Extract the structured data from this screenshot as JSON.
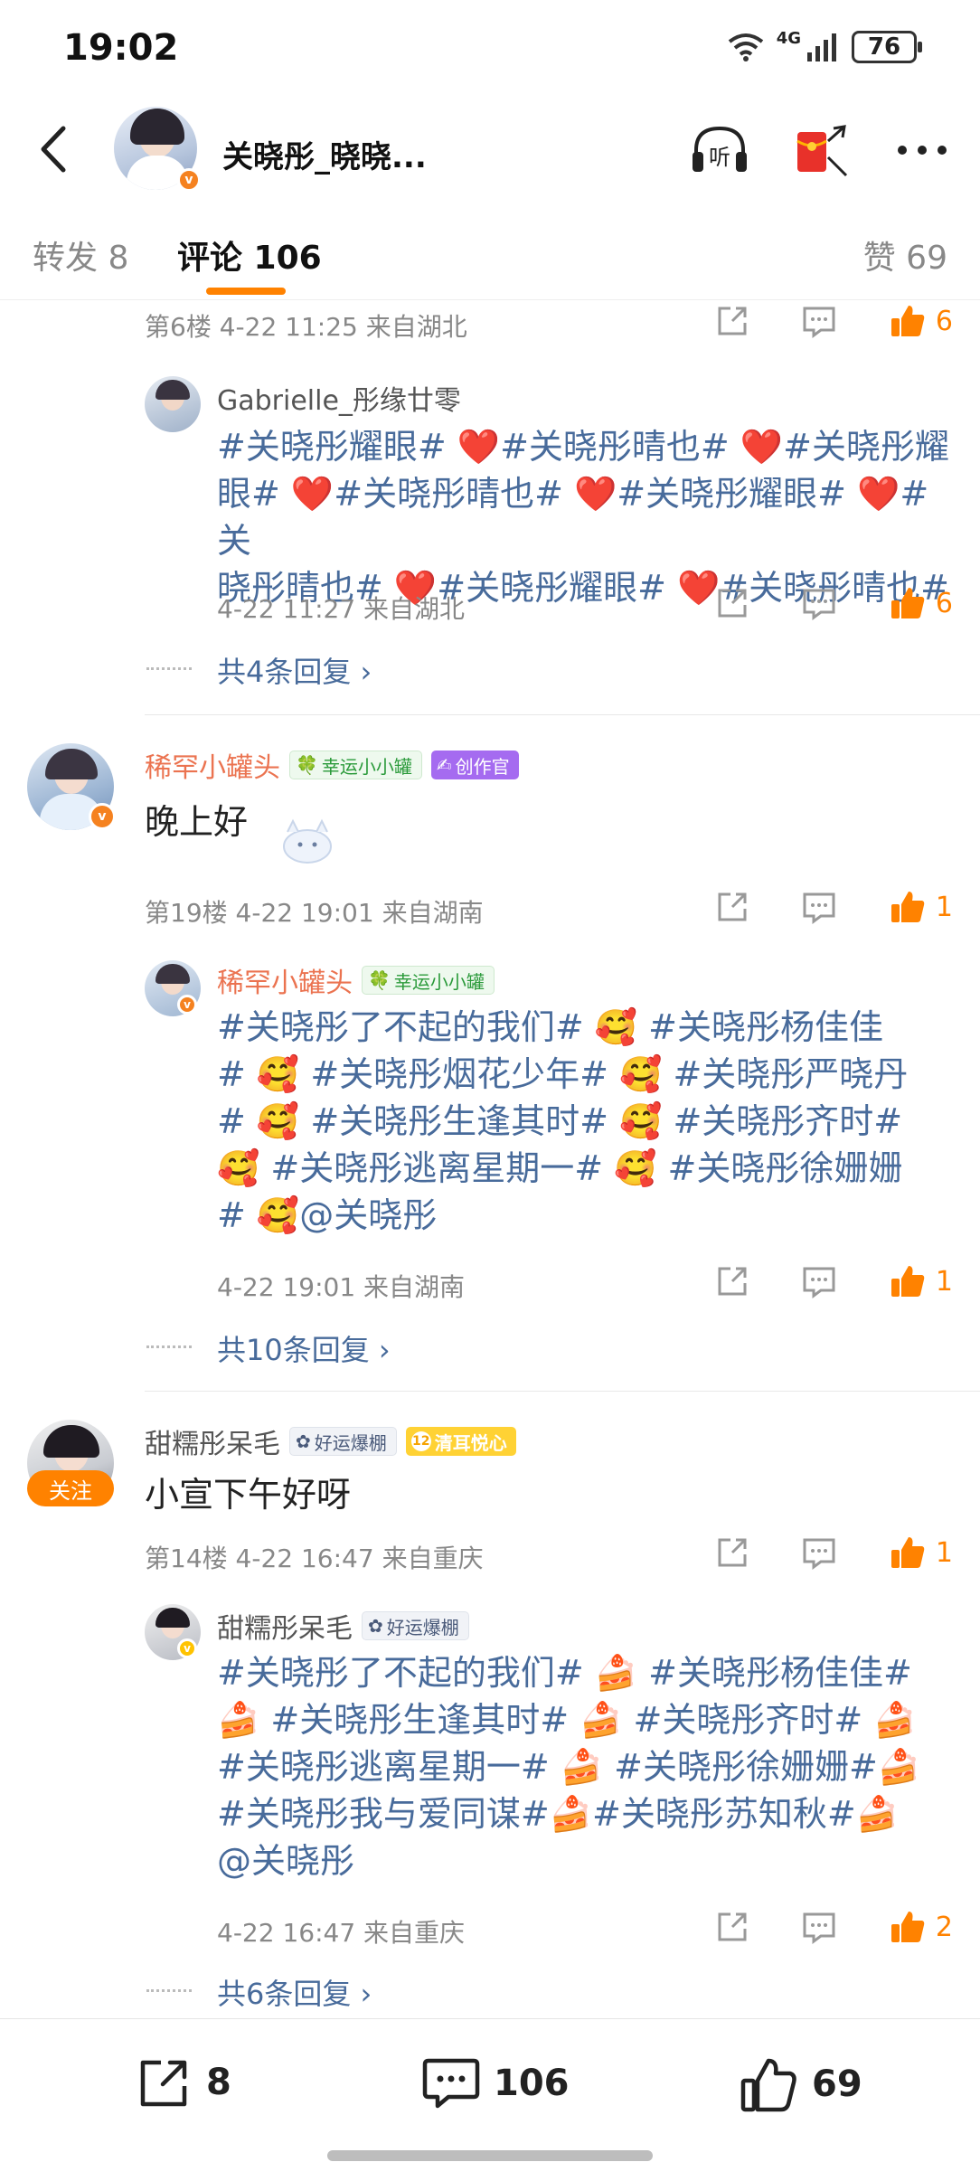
{
  "status_bar": {
    "time": "19:02",
    "network": "4G",
    "battery": "76"
  },
  "header": {
    "title": "关晓彤_晓晓..."
  },
  "tabs": [
    {
      "label": "转发 8"
    },
    {
      "label": "评论 106"
    },
    {
      "label": "赞 69"
    }
  ],
  "comments": [
    {
      "meta": "第6楼  4-22 11:25  来自湖北",
      "likes": "6",
      "reply": {
        "name": "Gabrielle_彤缘廿零",
        "lines": [
          "#关晓彤耀眼# ❤️#关晓彤晴也# ❤️#关晓彤耀",
          "眼# ❤️#关晓彤晴也# ❤️#关晓彤耀眼# ❤️#关",
          "晓彤晴也# ❤️#关晓彤耀眼# ❤️#关晓彤晴也#"
        ],
        "meta": "4-22 11:27  来自湖北",
        "likes": "6"
      },
      "replies_link": "共4条回复 ›"
    },
    {
      "name": "稀罕小罐头",
      "badges": [
        "幸运小小罐",
        "创作官"
      ],
      "text": "晚上好",
      "meta": "第19楼  4-22 19:01  来自湖南",
      "likes": "1",
      "reply": {
        "name": "稀罕小罐头",
        "badge": "幸运小小罐",
        "lines": [
          "#关晓彤了不起的我们# 🥰 #关晓彤杨佳佳",
          "# 🥰 #关晓彤烟花少年# 🥰 #关晓彤严晓丹",
          "# 🥰 #关晓彤生逢其时# 🥰 #关晓彤齐时#",
          "🥰 #关晓彤逃离星期一# 🥰 #关晓彤徐姗姗",
          "# 🥰@关晓彤"
        ],
        "meta": "4-22 19:01  来自湖南",
        "likes": "1"
      },
      "replies_link": "共10条回复 ›"
    },
    {
      "name": "甜糯彤呆毛",
      "badges": [
        "好运爆棚",
        "清耳悦心"
      ],
      "badge_level": "12",
      "follow": "关注",
      "text": "小宣下午好呀",
      "meta": "第14楼  4-22 16:47  来自重庆",
      "likes": "1",
      "reply": {
        "name": "甜糯彤呆毛",
        "badge": "好运爆棚",
        "lines": [
          "#关晓彤了不起的我们# 🍰 #关晓彤杨佳佳#",
          "🍰 #关晓彤生逢其时# 🍰 #关晓彤齐时# 🍰",
          "#关晓彤逃离星期一# 🍰 #关晓彤徐姗姗#🍰",
          "#关晓彤我与爱同谋#🍰#关晓彤苏知秋#🍰",
          "@关晓彤"
        ],
        "meta": "4-22 16:47  来自重庆",
        "likes": "2"
      },
      "replies_link": "共6条回复 ›"
    }
  ],
  "bottom_bar": {
    "repost_count": "8",
    "comment_count": "106",
    "like_count": "69"
  },
  "colors": {
    "accent": "#ff8200",
    "link": "#486b9b",
    "name_orange": "#eb7350"
  }
}
